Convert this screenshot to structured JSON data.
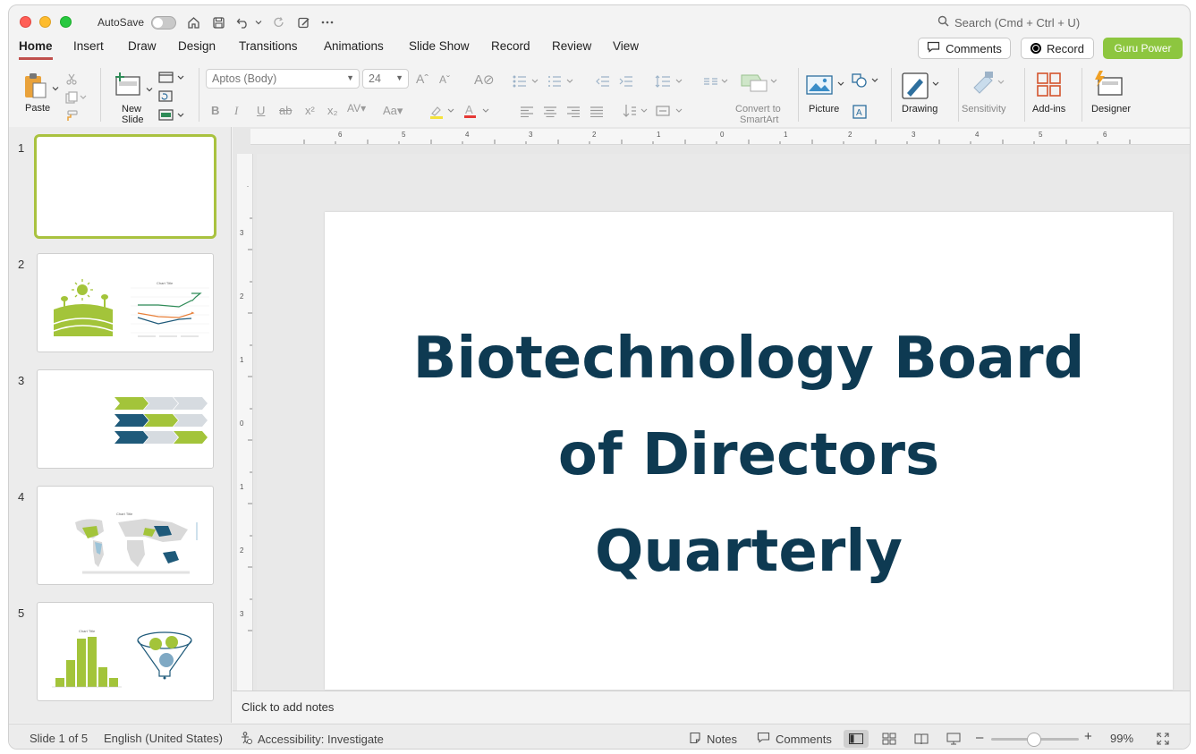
{
  "titlebar": {
    "autosave_label": "AutoSave",
    "search_placeholder": "Search (Cmd + Ctrl + U)"
  },
  "tabs": [
    {
      "label": "Home"
    },
    {
      "label": "Insert"
    },
    {
      "label": "Draw"
    },
    {
      "label": "Design"
    },
    {
      "label": "Transitions"
    },
    {
      "label": "Animations"
    },
    {
      "label": "Slide Show"
    },
    {
      "label": "Record"
    },
    {
      "label": "Review"
    },
    {
      "label": "View"
    }
  ],
  "actions": {
    "comments_label": "Comments",
    "record_label": "Record",
    "guru_label": "Guru Power"
  },
  "ribbon": {
    "paste_label": "Paste",
    "new_slide_label_1": "New",
    "new_slide_label_2": "Slide",
    "font_name": "Aptos (Body)",
    "font_size": "24",
    "convert_label_1": "Convert to",
    "convert_label_2": "SmartArt",
    "picture_label": "Picture",
    "drawing_label": "Drawing",
    "sensitivity_label": "Sensitivity",
    "addins_label": "Add-ins",
    "designer_label": "Designer"
  },
  "slides": [
    {
      "number": "1"
    },
    {
      "number": "2",
      "chart_title": "Chart Title"
    },
    {
      "number": "3"
    },
    {
      "number": "4",
      "chart_title": "Chart Title"
    },
    {
      "number": "5",
      "chart_title": "Chart Title"
    }
  ],
  "ruler": {
    "horizontal": [
      "6",
      "5",
      "4",
      "3",
      "2",
      "1",
      "0",
      "1",
      "2",
      "3",
      "4",
      "5",
      "6"
    ],
    "vertical": [
      "3",
      "2",
      "1",
      "0",
      "1",
      "2",
      "3"
    ]
  },
  "slide": {
    "title_line1": "Biotechnology Board",
    "title_line2": "of Directors",
    "title_line3": "Quarterly"
  },
  "notes_placeholder": "Click to add notes",
  "status": {
    "slide_info": "Slide 1 of 5",
    "language": "English (United States)",
    "accessibility": "Accessibility: Investigate",
    "notes_label": "Notes",
    "comments_label": "Comments",
    "zoom": "99%"
  },
  "colors": {
    "accent_tab": "#c0504d",
    "guru_button": "#8dc63f",
    "title_text": "#0e3a52",
    "thumb_selected_border": "#a9c23f",
    "lime": "#a3c43a",
    "navy": "#1f5a7a"
  }
}
